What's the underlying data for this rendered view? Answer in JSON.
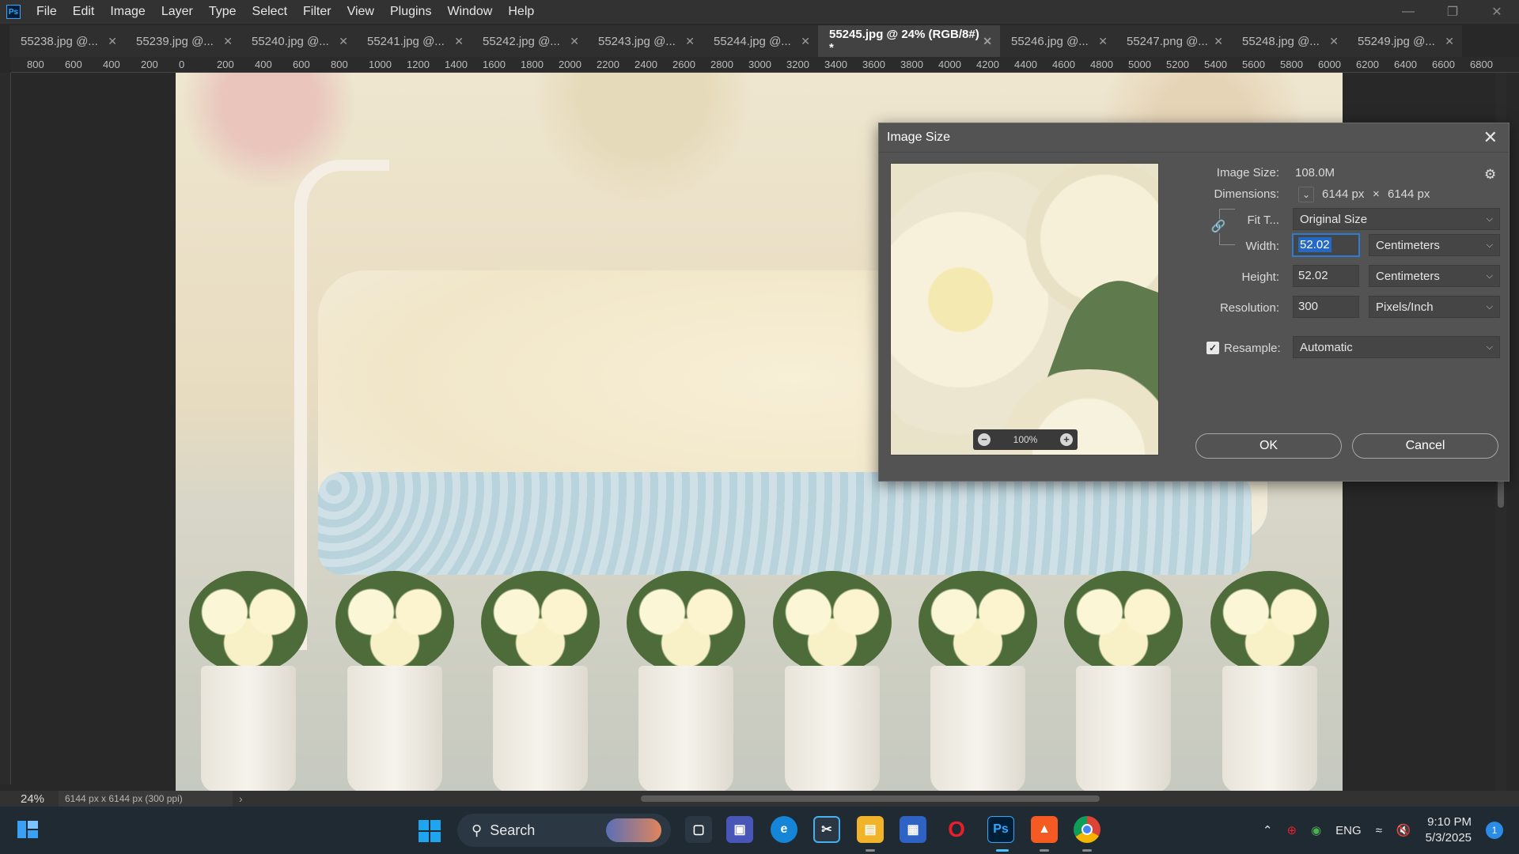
{
  "app": {
    "logo": "Ps"
  },
  "menu": [
    "File",
    "Edit",
    "Image",
    "Layer",
    "Type",
    "Select",
    "Filter",
    "View",
    "Plugins",
    "Window",
    "Help"
  ],
  "tabs": [
    {
      "label": "55238.jpg @..."
    },
    {
      "label": "55239.jpg @..."
    },
    {
      "label": "55240.jpg @..."
    },
    {
      "label": "55241.jpg @..."
    },
    {
      "label": "55242.jpg @..."
    },
    {
      "label": "55243.jpg @..."
    },
    {
      "label": "55244.jpg @..."
    },
    {
      "label": "55245.jpg @ 24% (RGB/8#) *",
      "active": true
    },
    {
      "label": "55246.jpg @..."
    },
    {
      "label": "55247.png @..."
    },
    {
      "label": "55248.jpg @..."
    },
    {
      "label": "55249.jpg @..."
    }
  ],
  "ruler_h_labels": [
    "800",
    "600",
    "400",
    "200",
    "0",
    "200",
    "400",
    "600",
    "800",
    "1000",
    "1200",
    "1400",
    "1600",
    "1800",
    "2000",
    "2200",
    "2400",
    "2600",
    "2800",
    "3000",
    "3200",
    "3400",
    "3600",
    "3800",
    "4000",
    "4200",
    "4400",
    "4600",
    "4800",
    "5000",
    "5200",
    "5400",
    "5600",
    "5800",
    "6000",
    "6200",
    "6400",
    "6600",
    "6800"
  ],
  "status": {
    "zoom": "24%",
    "doc_info": "6144 px x 6144 px (300 ppi)"
  },
  "dialog": {
    "title": "Image Size",
    "image_size_label": "Image Size:",
    "image_size_value": "108.0M",
    "dimensions_label": "Dimensions:",
    "dimensions_w": "6144 px",
    "dimensions_x": "×",
    "dimensions_h": "6144 px",
    "fit_label": "Fit T...",
    "fit_value": "Original Size",
    "width_label": "Width:",
    "width_value": "52.02",
    "width_unit": "Centimeters",
    "height_label": "Height:",
    "height_value": "52.02",
    "height_unit": "Centimeters",
    "resolution_label": "Resolution:",
    "resolution_value": "300",
    "resolution_unit": "Pixels/Inch",
    "resample_label": "Resample:",
    "resample_checked": true,
    "resample_value": "Automatic",
    "preview_zoom": "100%",
    "ok_label": "OK",
    "cancel_label": "Cancel"
  },
  "taskbar": {
    "search_label": "Search",
    "lang": "ENG",
    "time": "9:10 PM",
    "date": "5/3/2025",
    "notification_count": "1",
    "apps": [
      "file-explorer",
      "edge",
      "teams",
      "snipping-tool",
      "store",
      "opera",
      "photoshop",
      "brave",
      "chrome"
    ]
  },
  "colors": {
    "accent": "#2469c6",
    "ps_blue": "#31a8ff",
    "dialog_bg": "#535353"
  }
}
